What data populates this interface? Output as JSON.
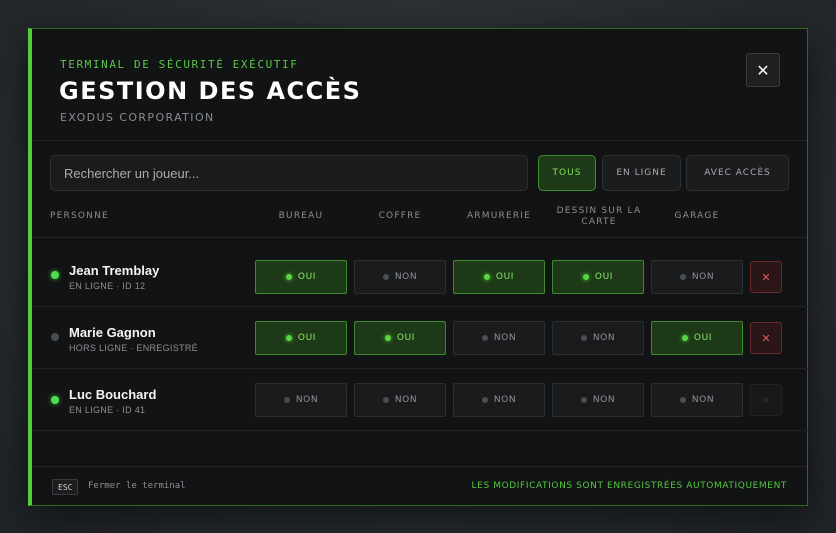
{
  "header": {
    "kicker": "TERMINAL DE SÉCURITÉ EXÉCUTIF",
    "title": "GESTION DES ACCÈS",
    "subtitle": "EXODUS CORPORATION",
    "close_label": "✕"
  },
  "search": {
    "placeholder": "Rechercher un joueur...",
    "value": ""
  },
  "filters": [
    {
      "label": "TOUS",
      "active": true
    },
    {
      "label": "EN LIGNE",
      "active": false
    },
    {
      "label": "AVEC ACCÈS",
      "active": false
    }
  ],
  "columns": {
    "person": "PERSONNE",
    "access": [
      "BUREAU",
      "COFFRE",
      "ARMURERIE",
      "DESSIN SUR LA CARTE",
      "GARAGE"
    ]
  },
  "labels": {
    "on": "OUI",
    "off": "NON",
    "revoke": "✕"
  },
  "players": [
    {
      "name": "Jean Tremblay",
      "meta": "EN LIGNE · ID 12",
      "online": true,
      "access": [
        "OUI",
        "NON",
        "OUI",
        "OUI",
        "NON"
      ],
      "revoke_enabled": true
    },
    {
      "name": "Marie Gagnon",
      "meta": "HORS LIGNE · ENREGISTRÉ",
      "online": false,
      "access": [
        "OUI",
        "OUI",
        "NON",
        "NON",
        "OUI"
      ],
      "revoke_enabled": true
    },
    {
      "name": "Luc Bouchard",
      "meta": "EN LIGNE · ID 41",
      "online": true,
      "access": [
        "NON",
        "NON",
        "NON",
        "NON",
        "NON"
      ],
      "revoke_enabled": false
    }
  ],
  "footer": {
    "key": "ESC",
    "key_label": "Fermer le terminal",
    "autosave": "LES MODIFICATIONS SONT ENREGISTRÉES AUTOMATIQUEMENT"
  },
  "colors": {
    "accent": "#4fcf3a",
    "on_text": "#88ea6a",
    "danger": "#e05a5e",
    "panel": "#121314"
  }
}
